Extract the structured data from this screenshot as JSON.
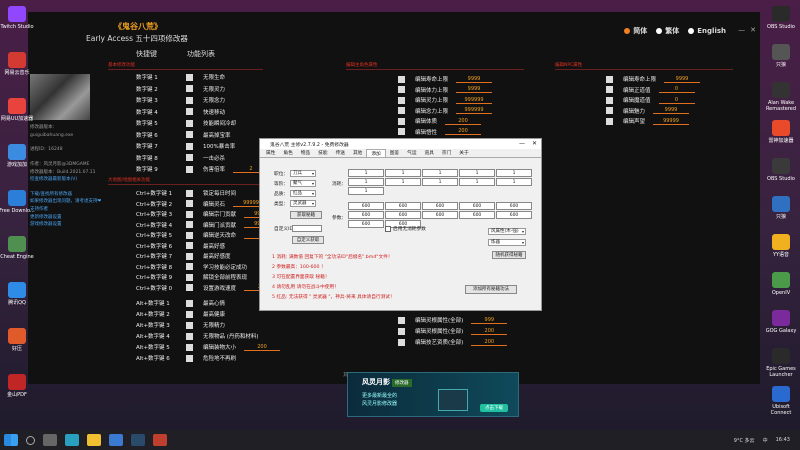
{
  "desktop_left": [
    {
      "label": "Twitch Studio",
      "color": "#9146ff"
    },
    {
      "label": "网易云音乐",
      "color": "#d33a31"
    },
    {
      "label": "网易UU加速器",
      "color": "#e8433d"
    },
    {
      "label": "游戏加加",
      "color": "#3b8ce0"
    },
    {
      "label": "Free Downlo...",
      "color": "#2b7fd9"
    },
    {
      "label": "Cheat Engine",
      "color": "#4f8f4f"
    },
    {
      "label": "腾讯QQ",
      "color": "#2e8ce6"
    },
    {
      "label": "好压",
      "color": "#e05a2a"
    },
    {
      "label": "金山PDF",
      "color": "#c02626"
    }
  ],
  "desktop_right": [
    {
      "label": "OBS Studio",
      "color": "#2a2a2a"
    },
    {
      "label": "只狼",
      "color": "#555555"
    },
    {
      "label": "Alan Wake Remastered",
      "color": "#333333"
    },
    {
      "label": "雷神加速器",
      "color": "#e84a2a"
    },
    {
      "label": "OBS Studio",
      "color": "#3a3a3a"
    },
    {
      "label": "只狼",
      "color": "#3070c0"
    },
    {
      "label": "YY语音",
      "color": "#f0b020"
    },
    {
      "label": "OpenIV",
      "color": "#4a9a4a"
    },
    {
      "label": "GOG Galaxy",
      "color": "#7a2a9a"
    },
    {
      "label": "Epic Games Launcher",
      "color": "#2a2a2a"
    },
    {
      "label": "Ubisoft Connect",
      "color": "#2a6ad0"
    }
  ],
  "trainer": {
    "logo": "《鬼谷八荒》",
    "subtitle": "Early Access 五十四项修改器",
    "lang": {
      "simplified": "简体",
      "traditional": "繁体",
      "english": "English"
    },
    "winbtns": {
      "min": "—",
      "close": "✕"
    },
    "col_hotkey": "快捷键",
    "col_func": "功能列表",
    "info": [
      "修改器版本：",
      "guiguibahuang.exe",
      "",
      "进程ID：16248",
      "",
      "作者：风灵月影@3DMGAME",
      "修改器版本：Build.2021.07.11",
      "检查修改器最新版本(V)",
      "",
      "下载/查找所有修改器",
      "如果修改器出现问题，请考虑支持❤",
      "支持作者",
      "更新修改器设置",
      "游戏修改器设置"
    ],
    "sections": {
      "base": "基本修改功能",
      "main_edit": "编辑主角色属性",
      "npc_edit": "编辑NPC属性",
      "map": "大地图/地图相关功能"
    },
    "rows1": [
      {
        "key": "数字键 1",
        "label": "无限生命"
      },
      {
        "key": "数字键 2",
        "label": "无限灵力"
      },
      {
        "key": "数字键 3",
        "label": "无限念力"
      },
      {
        "key": "数字键 4",
        "label": "快速移动"
      },
      {
        "key": "数字键 5",
        "label": "技能瞬间冷却"
      },
      {
        "key": "数字键 6",
        "label": "最高掉宝率"
      },
      {
        "key": "数字键 7",
        "label": "100%暴击率"
      },
      {
        "key": "数字键 8",
        "label": "一击必杀"
      },
      {
        "key": "数字键 9",
        "label": "伤害倍率",
        "value": "2"
      }
    ],
    "rows2": [
      {
        "key": "Ctrl+数字键 1",
        "label": "锁定每日时间"
      },
      {
        "key": "Ctrl+数字键 2",
        "label": "编辑灵石",
        "value": "99999"
      },
      {
        "key": "Ctrl+数字键 3",
        "label": "编辑宗门贡献",
        "value": "99999"
      },
      {
        "key": "Ctrl+数字键 4",
        "label": "编辑门派贡献",
        "value": "99999"
      },
      {
        "key": "Ctrl+数字键 5",
        "label": "编辑逆天改命",
        "value": "5"
      },
      {
        "key": "Ctrl+数字键 6",
        "label": "最高好感"
      },
      {
        "key": "Ctrl+数字键 7",
        "label": "最高好感度"
      },
      {
        "key": "Ctrl+数字键 8",
        "label": "学习技能必定成功"
      },
      {
        "key": "Ctrl+数字键 9",
        "label": "解锁全部前程表现"
      },
      {
        "key": "Ctrl+数字键 0",
        "label": "设置游戏速度",
        "value": "2.0"
      }
    ],
    "rows3": [
      {
        "key": "Alt+数字键 1",
        "label": "最高心情"
      },
      {
        "key": "Alt+数字键 2",
        "label": "最高健康"
      },
      {
        "key": "Alt+数字键 3",
        "label": "无限精力"
      },
      {
        "key": "Alt+数字键 4",
        "label": "无限物品 (丹药和材料)"
      },
      {
        "key": "Alt+数字键 5",
        "label": "编辑装物大小",
        "value": "200"
      },
      {
        "key": "Alt+数字键 6",
        "label": "危险地不再刷"
      }
    ],
    "mid_rows": [
      {
        "label": "编辑寿命上限",
        "value": "9999"
      },
      {
        "label": "编辑体力上限",
        "value": "9999"
      },
      {
        "label": "编辑灵力上限",
        "value": "999999"
      },
      {
        "label": "编辑念力上限",
        "value": "999999"
      },
      {
        "label": "编辑体质",
        "value": "200"
      },
      {
        "label": "编辑悟性",
        "value": "200"
      }
    ],
    "mid_bottom": [
      {
        "label": "编辑灵根属性(全部)",
        "value": "999"
      },
      {
        "label": "编辑灵根属性(全部)",
        "value": "200"
      },
      {
        "label": "编辑技艺资质(全部)",
        "value": "200"
      }
    ],
    "npc_rows": [
      {
        "label": "编辑寿命上限",
        "value": "9999"
      },
      {
        "label": "编辑正道值",
        "value": "0"
      },
      {
        "label": "编辑魔道值",
        "value": "0"
      },
      {
        "label": "编辑魅力",
        "value": "9999"
      },
      {
        "label": "编辑声望",
        "value": "99999"
      }
    ],
    "footer": "其他说明：Ctrl+Shift+Home启用/启用快捷键；免费修改器，希望玩家广告支持！",
    "ad": {
      "brand": "风灵月影",
      "tag": "修改器",
      "line1": "更多最新最全的",
      "line2": "风灵月影修改器",
      "button": "点击下载"
    }
  },
  "dialog": {
    "title": "鬼谷八荒 主修v2.7.9.2 - 免费修改器",
    "tabs": [
      "属性",
      "角色",
      "物品",
      "技能",
      "传送",
      "其他",
      "添加",
      "图鉴",
      "气运",
      "道具",
      "宗门",
      "关于"
    ],
    "active_tab": 6,
    "left_fields": [
      {
        "label": "职位：",
        "value": "刀兵"
      },
      {
        "label": "等阶：",
        "value": "聚气"
      },
      {
        "label": "品质：",
        "value": "红品"
      },
      {
        "label": "类型：",
        "value": "灵武器"
      }
    ],
    "btn_get": "获取秘籍",
    "consume_label": "消耗：",
    "param_label": "参数：",
    "consume_vals": [
      "1",
      "1",
      "1",
      "1",
      "1",
      "1",
      "1",
      "1",
      "1",
      "1",
      "1"
    ],
    "param_vals": [
      "600",
      "600",
      "600",
      "600",
      "600",
      "600",
      "600",
      "600",
      "600",
      "600",
      "600",
      "600"
    ],
    "checkbox_label": "启用无消耗参数",
    "custom_label": "自定义ID：",
    "btn_custom": "自定义获取",
    "right_sel1": "风属性(木-强)",
    "right_sel2": "炼器",
    "btn_random": "随机获得秘籍",
    "notes": [
      "1 消耗: 满数值 回复下的 \"全功法ID\"后缀名\".bmd\"文件！",
      "2 参数最高：100-600 ！",
      "3 可在配置界面获取 秘籍！",
      "4 请勿乱用 请勿在战斗中使用！",
      "5 红品: 无法获得 \" 灵武器 \"，神兵-将来 具体请自行测试！"
    ],
    "btn_all": "添加所有秘籍功法"
  },
  "taskbar": {
    "weather": "9°C 多云",
    "time": "16:43",
    "lang": "中"
  }
}
